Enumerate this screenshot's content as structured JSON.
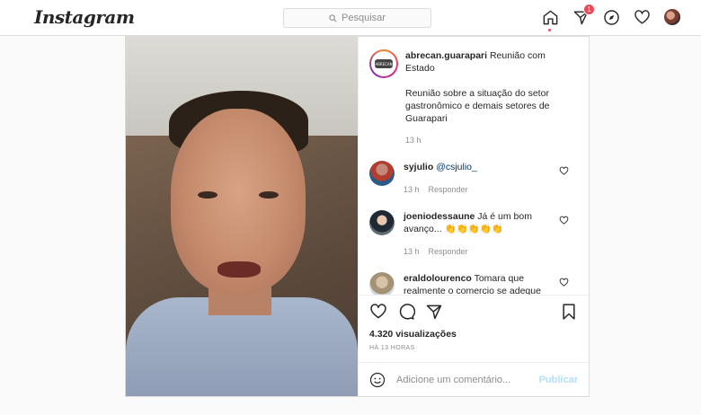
{
  "header": {
    "logo": "Instagram",
    "search_placeholder": "Pesquisar",
    "notification_count": "1"
  },
  "post": {
    "owner": "abrecan.guarapari",
    "title": "Reunião com Estado",
    "description": "Reunião sobre a situação do setor gastronômico e demais setores de Guarapari",
    "time": "13 h",
    "views": "4.320 visualizações",
    "posted_ago": "HÁ 13 HORAS"
  },
  "comments": [
    {
      "user": "syjulio",
      "text": "@csjulio_",
      "time": "13 h",
      "reply": "Responder"
    },
    {
      "user": "joeniodessaune",
      "text": "Já é um bom avanço... 👏👏👏👏👏",
      "time": "13 h",
      "reply": "Responder"
    },
    {
      "user": "eraldolourenco",
      "text": "Tomara que realmente o comercio se adeque"
    }
  ],
  "add_comment": {
    "placeholder": "Adicione um comentário...",
    "publish": "Publicar"
  }
}
